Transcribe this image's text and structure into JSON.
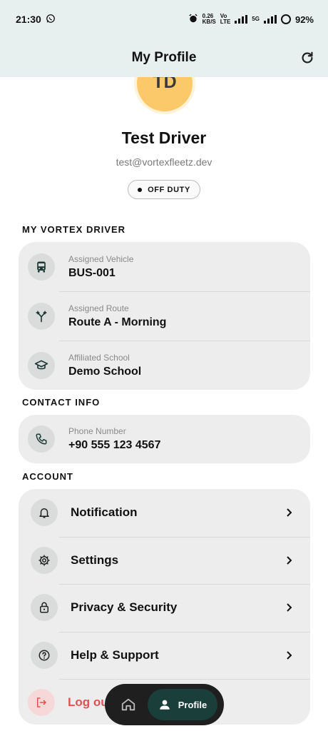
{
  "status_bar": {
    "time": "21:30",
    "net_speed_top": "0.26",
    "net_speed_bottom": "KB/S",
    "volte_top": "Vo",
    "volte_bottom": "LTE",
    "fiveg": "5G",
    "battery": "92%"
  },
  "header": {
    "title": "My Profile"
  },
  "profile": {
    "initials": "TD",
    "name": "Test Driver",
    "email": "test@vortexfleetz.dev",
    "status": "OFF DUTY"
  },
  "sections": {
    "driver": "MY VORTEX DRIVER",
    "contact": "CONTACT INFO",
    "account": "ACCOUNT"
  },
  "driver_info": [
    {
      "label": "Assigned Vehicle",
      "value": "BUS-001",
      "icon": "bus-icon"
    },
    {
      "label": "Assigned Route",
      "value": "Route A - Morning",
      "icon": "route-fork-icon"
    },
    {
      "label": "Affiliated School",
      "value": "Demo School",
      "icon": "graduation-cap-icon"
    }
  ],
  "contact_info": [
    {
      "label": "Phone Number",
      "value": "+90 555 123 4567",
      "icon": "phone-icon"
    }
  ],
  "account_menu": [
    {
      "label": "Notification",
      "icon": "bell-icon"
    },
    {
      "label": "Settings",
      "icon": "gear-icon"
    },
    {
      "label": "Privacy & Security",
      "icon": "lock-icon"
    },
    {
      "label": "Help & Support",
      "icon": "help-circle-icon"
    },
    {
      "label": "Log out",
      "icon": "logout-icon"
    }
  ],
  "bottom_nav": {
    "profile_label": "Profile"
  },
  "colors": {
    "accent": "#1a3f3a",
    "avatar": "#fcc96a",
    "danger": "#e05252",
    "card": "#ededed"
  }
}
